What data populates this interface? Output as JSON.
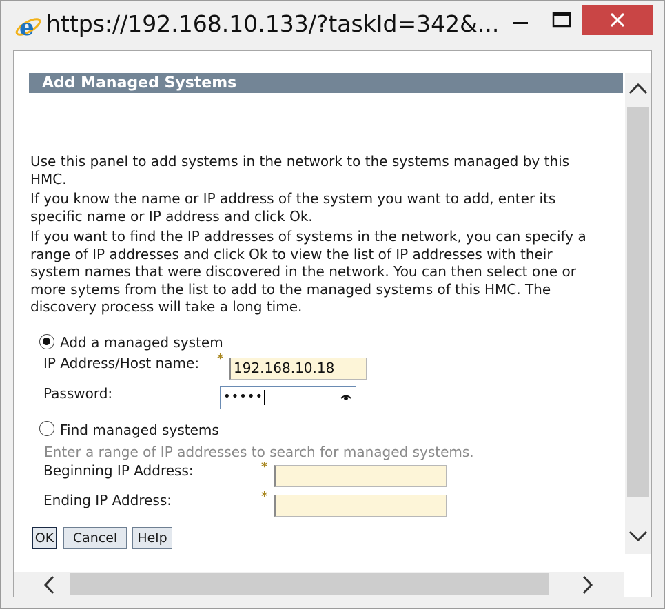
{
  "window": {
    "title": "https://192.168.10.133/?taskId=342&...",
    "close_color": "#c94545"
  },
  "panel": {
    "title": "Add Managed Systems",
    "title_bar_color": "#738596",
    "description": [
      "Use this panel to add systems in the network to the systems managed by this\nHMC.",
      "If you know the name or IP address of the system you want to add, enter its\nspecific name or IP address and click Ok.",
      "If you want to find the IP addresses of systems in the network, you can specify a\nrange of IP addresses and click Ok to view the list of IP addresses with their\nsystem names that were discovered in the network. You can then select one or\nmore sytems from the list to add to the managed systems of this HMC. The\ndiscovery process will take a long time."
    ]
  },
  "add_system": {
    "radio_label": "Add a managed system",
    "selected": true,
    "host_label": "IP Address/Host name:",
    "host_value": "192.168.10.18",
    "password_label": "Password:",
    "password_value": "•••••"
  },
  "find_systems": {
    "radio_label": "Find managed systems",
    "selected": false,
    "hint": "Enter a range of IP addresses to search for managed systems.",
    "begin_label": "Beginning IP Address:",
    "begin_value": "",
    "end_label": "Ending IP Address:",
    "end_value": ""
  },
  "buttons": {
    "ok": "OK",
    "cancel": "Cancel",
    "help": "Help"
  },
  "required_marker": "*",
  "icons": [
    "internet-explorer-icon",
    "minimize-icon",
    "maximize-icon",
    "close-icon",
    "show-password-icon",
    "scroll-up-icon",
    "scroll-down-icon",
    "scroll-left-icon",
    "scroll-right-icon"
  ]
}
